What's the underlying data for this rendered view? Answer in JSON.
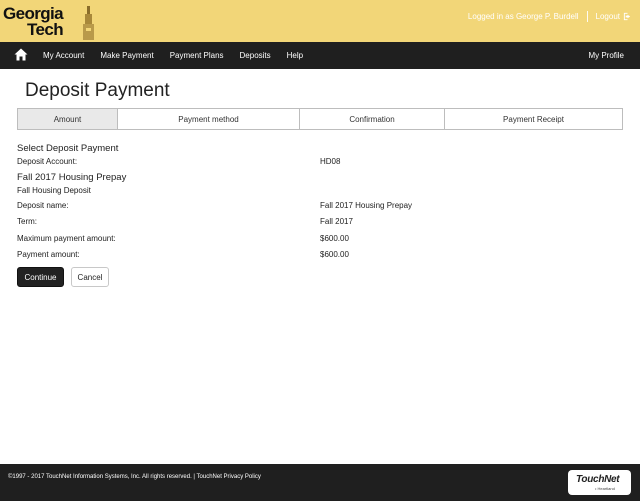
{
  "brand": {
    "logo_line1": "Georgia",
    "logo_line2": "Tech"
  },
  "header": {
    "logged_in_text": "Logged in as George P. Burdell",
    "logout_label": "Logout"
  },
  "nav": {
    "home_icon": "home-icon",
    "items": [
      {
        "label": "My Account"
      },
      {
        "label": "Make Payment"
      },
      {
        "label": "Payment Plans"
      },
      {
        "label": "Deposits"
      },
      {
        "label": "Help"
      }
    ],
    "profile_label": "My Profile"
  },
  "page": {
    "title": "Deposit Payment"
  },
  "steps": [
    {
      "label": "Amount",
      "active": true
    },
    {
      "label": "Payment method",
      "active": false
    },
    {
      "label": "Confirmation",
      "active": false
    },
    {
      "label": "Payment Receipt",
      "active": false
    }
  ],
  "deposit": {
    "section_heading": "Select Deposit Payment",
    "account_label": "Deposit Account:",
    "account_value": "HD08",
    "deposit_heading": "Fall 2017 Housing Prepay",
    "deposit_sub": "Fall Housing Deposit",
    "name_label": "Deposit name:",
    "name_value": "Fall 2017 Housing Prepay",
    "term_label": "Term:",
    "term_value": "Fall 2017",
    "max_label": "Maximum payment amount:",
    "max_value": "$600.00",
    "amount_label": "Payment amount:",
    "amount_value": "$600.00"
  },
  "actions": {
    "continue_label": "Continue",
    "cancel_label": "Cancel"
  },
  "footer": {
    "copyright": "©1997 - 2017  TouchNet Information Systems, Inc. All rights reserved. | TouchNet Privacy Policy",
    "touchnet_logo": "TouchNet",
    "touchnet_tagline": "• Heartland"
  },
  "colors": {
    "header_bg": "#f2d678",
    "nav_bg": "#1f1f1f",
    "primary_button": "#222222",
    "active_step": "#e9e9e9"
  }
}
